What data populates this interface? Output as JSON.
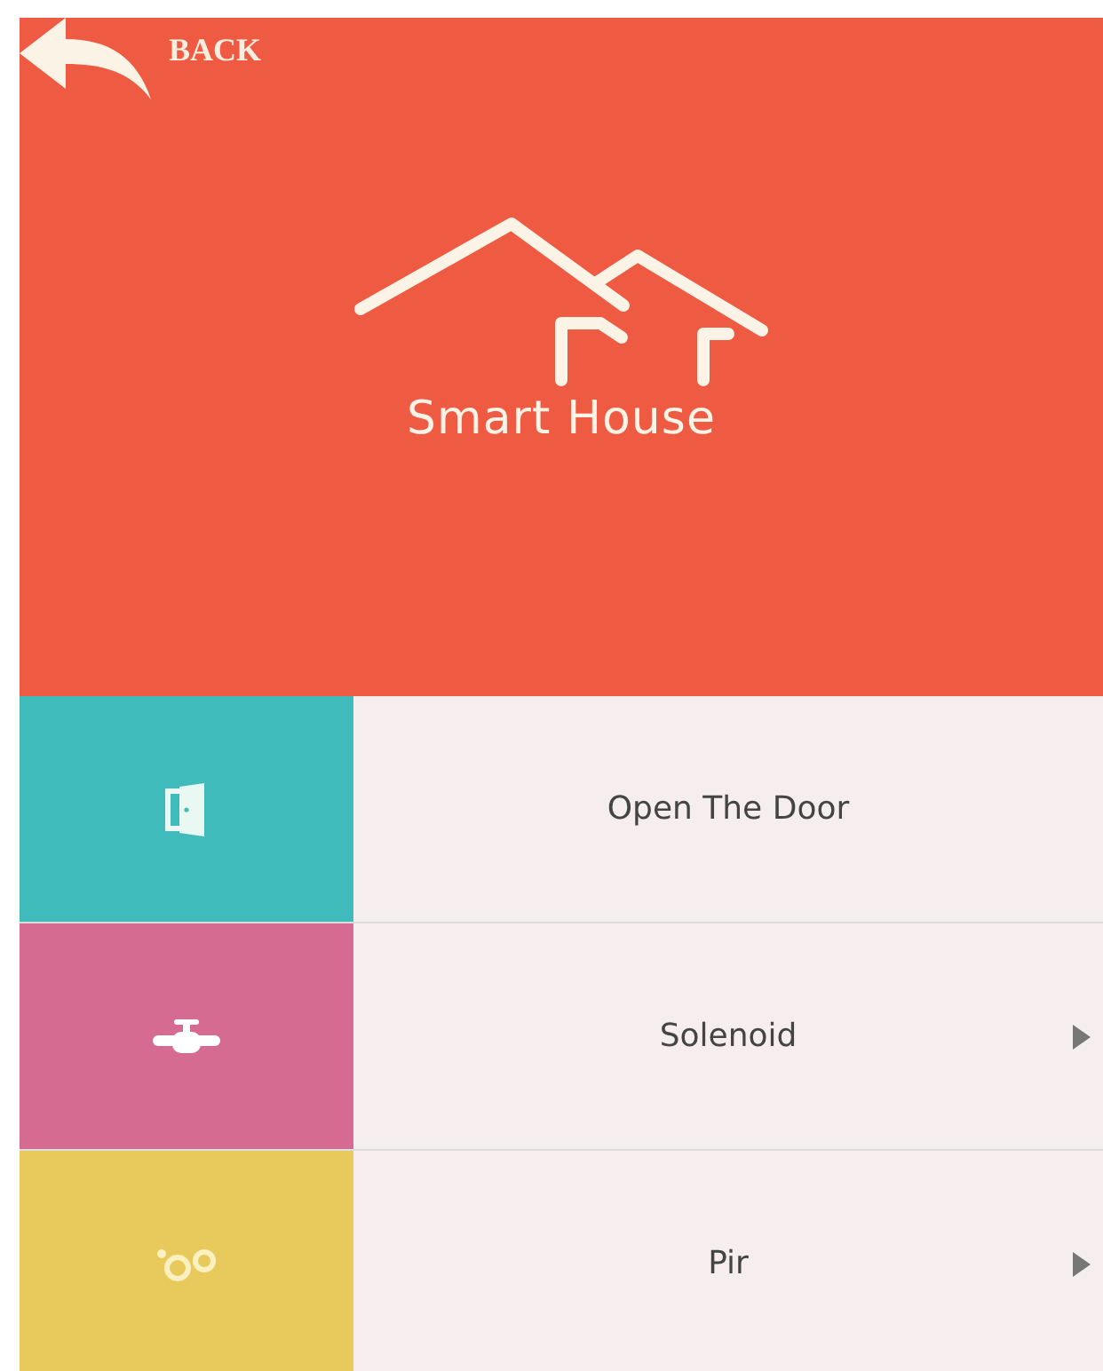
{
  "header": {
    "back_label": "BACK",
    "title": "Smart House"
  },
  "menu": [
    {
      "label": "Open The Door",
      "kind": "door",
      "color": "#3fbbbb",
      "chevron": false
    },
    {
      "label": "Solenoid",
      "kind": "tap",
      "color": "#d66b91",
      "chevron": true
    },
    {
      "label": "Pir",
      "kind": "bubbles",
      "color": "#e8c95b",
      "chevron": true
    }
  ]
}
